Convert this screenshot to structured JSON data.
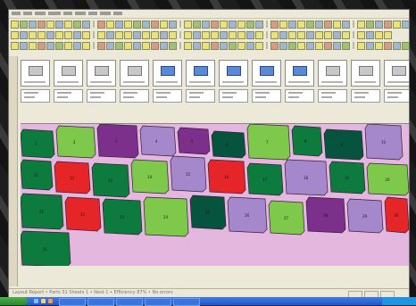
{
  "window": {
    "title": ""
  },
  "status_bar": {
    "text": "Layout Report • Parts 31 Sheets 1 • Nest 1 • Efficiency 87% • No errors"
  },
  "palette": {
    "sheet_bg": "#e4b7de",
    "dark_green": "#0d7a3e",
    "deep_teal": "#06533e",
    "light_green": "#7ec84c",
    "purple": "#7d2f8c",
    "lavender": "#a587cc",
    "red": "#e52528"
  },
  "part_library_count": 12,
  "nested_parts": [
    {
      "n": "1",
      "c": "#0d7a3e"
    },
    {
      "n": "2",
      "c": "#7ec84c"
    },
    {
      "n": "3",
      "c": "#7d2f8c"
    },
    {
      "n": "4",
      "c": "#a587cc"
    },
    {
      "n": "5",
      "c": "#7d2f8c"
    },
    {
      "n": "6",
      "c": "#06533e"
    },
    {
      "n": "7",
      "c": "#7ec84c"
    },
    {
      "n": "8",
      "c": "#0d7a3e"
    },
    {
      "n": "9",
      "c": "#06533e"
    },
    {
      "n": "10",
      "c": "#a587cc"
    },
    {
      "n": "11",
      "c": "#0d7a3e"
    },
    {
      "n": "12",
      "c": "#e52528"
    },
    {
      "n": "13",
      "c": "#0d7a3e"
    },
    {
      "n": "14",
      "c": "#7ec84c"
    },
    {
      "n": "15",
      "c": "#a587cc"
    },
    {
      "n": "16",
      "c": "#e52528"
    },
    {
      "n": "17",
      "c": "#0d7a3e"
    },
    {
      "n": "18",
      "c": "#a587cc"
    },
    {
      "n": "19",
      "c": "#0d7a3e"
    },
    {
      "n": "20",
      "c": "#7ec84c"
    },
    {
      "n": "21",
      "c": "#0d7a3e"
    },
    {
      "n": "22",
      "c": "#e52528"
    },
    {
      "n": "23",
      "c": "#0d7a3e"
    },
    {
      "n": "24",
      "c": "#7ec84c"
    },
    {
      "n": "25",
      "c": "#06533e"
    },
    {
      "n": "26",
      "c": "#a587cc"
    },
    {
      "n": "27",
      "c": "#7ec84c"
    },
    {
      "n": "28",
      "c": "#7d2f8c"
    },
    {
      "n": "29",
      "c": "#a587cc"
    },
    {
      "n": "30",
      "c": "#e52528"
    },
    {
      "n": "31",
      "c": "#0d7a3e"
    }
  ]
}
